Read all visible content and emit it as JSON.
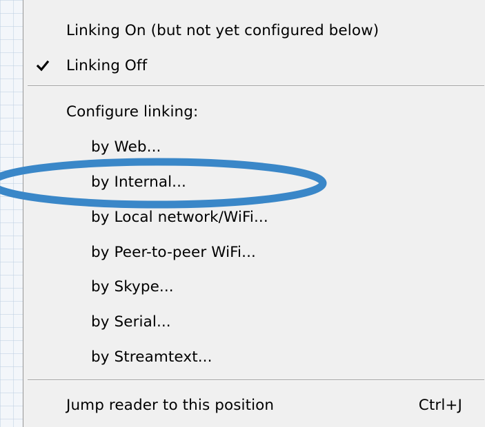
{
  "menu": {
    "linking_on": "Linking On (but not yet configured below)",
    "linking_off": "Linking Off",
    "linking_off_checked": true,
    "configure_header": "Configure linking:",
    "options": [
      "by Web...",
      "by Internal...",
      "by Local network/WiFi...",
      "by Peer-to-peer WiFi...",
      "by Skype...",
      "by Serial...",
      "by Streamtext..."
    ],
    "jump_reader": "Jump reader to this position",
    "jump_shortcut": "Ctrl+J"
  },
  "annotation": {
    "highlight_color": "#3a87c8",
    "highlighted_item": "by Internal..."
  },
  "colors": {
    "menu_background": "#f0f0f0",
    "page_background": "#f3f6fa"
  }
}
